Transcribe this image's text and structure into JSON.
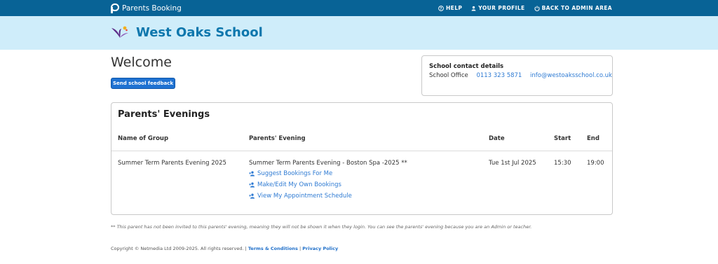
{
  "app": {
    "name": "Parents Booking"
  },
  "topnav": {
    "help": "HELP",
    "profile": "YOUR PROFILE",
    "admin": "BACK TO ADMIN AREA"
  },
  "school": {
    "name": "West Oaks School"
  },
  "welcome": {
    "title": "Welcome",
    "feedback_button": "Send school feedback"
  },
  "contact": {
    "title": "School contact details",
    "office_label": "School Office",
    "phone": "0113 323 5871",
    "email": "info@westoaksschool.co.uk"
  },
  "evenings": {
    "title": "Parents' Evenings",
    "columns": [
      "Name of Group",
      "Parents' Evening",
      "Date",
      "Start",
      "End"
    ],
    "rows": [
      {
        "group": "Summer Term Parents Evening 2025",
        "evening": "Summer Term Parents Evening - Boston Spa -2025 **",
        "date": "Tue 1st Jul 2025",
        "start": "15:30",
        "end": "19:00",
        "actions": [
          "Suggest Bookings For Me",
          "Make/Edit My Own Bookings",
          "View My Appointment Schedule"
        ]
      }
    ]
  },
  "note": "** This parent has not been invited to this parents' evening, meaning they will not be shown it when they login. You can see the parents' evening because you are an Admin or teacher.",
  "footer": {
    "copyright": "Copyright © Netmedia Ltd 2009-2025. All rights reserved. |",
    "terms": "Terms & Conditions",
    "separator": "|",
    "privacy": "Privacy Policy"
  },
  "colors": {
    "topbar": "#086396",
    "banner": "#cfedfa",
    "school_name": "#0e77ad",
    "link": "#2f7bd3",
    "button": "#1f72d2"
  },
  "icons": {
    "help": "help-circle-icon",
    "profile": "user-icon",
    "admin": "power-icon",
    "actions": "users-plus-icon"
  }
}
